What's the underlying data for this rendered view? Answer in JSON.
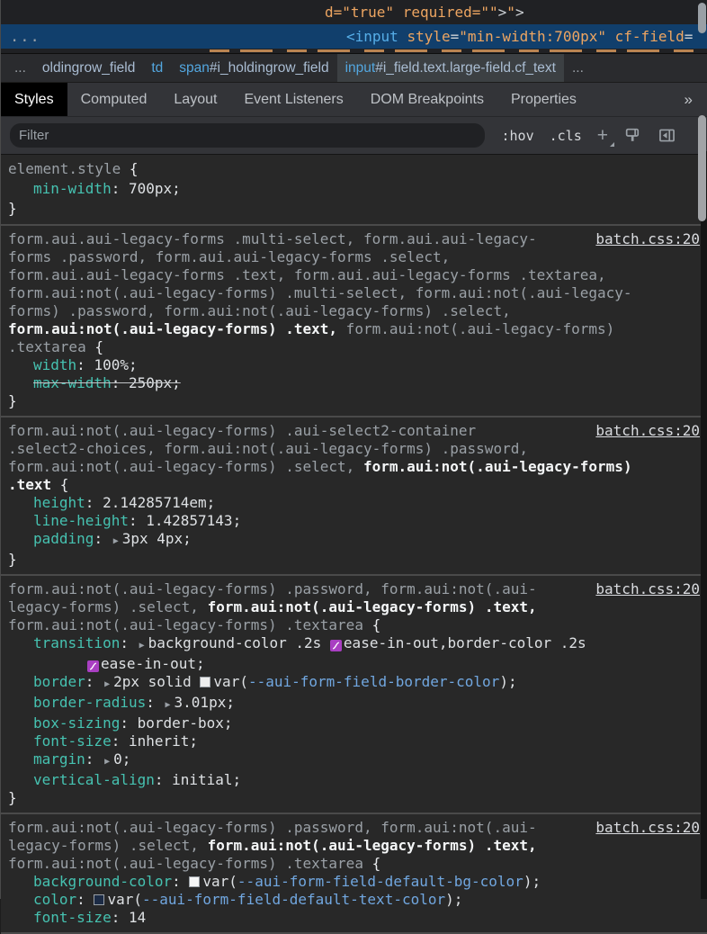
{
  "colors": {
    "selection_blue": "#113f6c",
    "property_teal": "#46c2b1",
    "var_link_blue": "#71a7e0",
    "bezier_purple": "#a93fc2",
    "attr_orange": "#eda561",
    "tag_blue": "#56aee8",
    "dim_gray": "#9aa0a6",
    "swatch_border_color": "#ededed",
    "swatch_bg_color": "#f5f5f5",
    "swatch_text_color": "#1c2b45"
  },
  "elements_panel": {
    "rows": [
      {
        "name": "code-row-attrs",
        "selected": false,
        "tokens": [
          {
            "t": "d=\"true\" required=\"\"",
            "c": "attr"
          },
          {
            "t": ">",
            "c": "punct"
          },
          {
            "t": "\"",
            "c": "attr"
          },
          {
            "t": ">",
            "c": "punct"
          }
        ]
      },
      {
        "name": "code-row-selected-input",
        "selected": true,
        "more": "...",
        "tokens": [
          {
            "t": "<input",
            "c": "tag"
          },
          {
            "t": " ",
            "c": "punct"
          },
          {
            "t": "style",
            "c": "attr"
          },
          {
            "t": "=",
            "c": "punct"
          },
          {
            "t": "\"min-width:700px\"",
            "c": "attr"
          },
          {
            "t": " ",
            "c": "punct"
          },
          {
            "t": "cf-field",
            "c": "attr"
          },
          {
            "t": "=",
            "c": "punct"
          }
        ]
      }
    ]
  },
  "breadcrumb": {
    "items": [
      {
        "parts": [
          {
            "t": "...",
            "c": "dim"
          }
        ]
      },
      {
        "parts": [
          {
            "t": "oldingrow_field",
            "c": "node"
          }
        ]
      },
      {
        "parts": [
          {
            "t": "td",
            "c": "tag"
          }
        ]
      },
      {
        "parts": [
          {
            "t": "span",
            "c": "tag"
          },
          {
            "t": "#i_holdingrow_field",
            "c": "node"
          }
        ]
      },
      {
        "selected": true,
        "parts": [
          {
            "t": "input",
            "c": "tag"
          },
          {
            "t": "#i_field.text.large-field.cf_text",
            "c": "node"
          }
        ]
      },
      {
        "parts": [
          {
            "t": "...",
            "c": "dim"
          }
        ]
      }
    ]
  },
  "tabs": {
    "items": [
      "Styles",
      "Computed",
      "Layout",
      "Event Listeners",
      "DOM Breakpoints",
      "Properties"
    ],
    "active": "Styles",
    "overflow": "»"
  },
  "styles_toolbar": {
    "filter_placeholder": "Filter",
    "pseudo_state_label": ":hov",
    "class_toggle_label": ".cls",
    "new_rule_label": "+"
  },
  "style_sections": [
    {
      "id": "element-style",
      "elem": true,
      "link": null,
      "selector_lines": [
        [
          {
            "t": "element.style",
            "c": "dim"
          },
          {
            "t": " {",
            "c": "brace"
          }
        ]
      ],
      "declarations": [
        {
          "tokens": [
            {
              "k": "prop",
              "v": "min-width"
            },
            {
              "k": "t",
              "v": ": "
            },
            {
              "k": "t",
              "v": "700px;"
            }
          ]
        }
      ],
      "close": "}"
    },
    {
      "id": "rule-1",
      "link": "batch.css:20",
      "selector_lines": [
        [
          {
            "t": "form.aui.aui-legacy-forms .multi-select, form.aui.aui-legacy-",
            "c": "dim"
          }
        ],
        [
          {
            "t": "forms .password, form.aui.aui-legacy-forms .select,",
            "c": "dim"
          }
        ],
        [
          {
            "t": "form.aui.aui-legacy-forms .text, form.aui.aui-legacy-forms .textarea,",
            "c": "dim"
          }
        ],
        [
          {
            "t": "form.aui:not(.aui-legacy-forms) .multi-select, form.aui:not(.aui-legacy-",
            "c": "dim"
          }
        ],
        [
          {
            "t": "forms) .password, form.aui:not(.aui-legacy-forms) .select,",
            "c": "dim"
          }
        ],
        [
          {
            "t": "form.aui:not(.aui-legacy-forms) .text,",
            "c": "bright"
          },
          {
            "t": " form.aui:not(.aui-legacy-forms)",
            "c": "dim"
          }
        ],
        [
          {
            "t": ".textarea",
            "c": "dim"
          },
          {
            "t": " {",
            "c": "brace"
          }
        ]
      ],
      "declarations": [
        {
          "tokens": [
            {
              "k": "prop",
              "v": "width"
            },
            {
              "k": "t",
              "v": ": "
            },
            {
              "k": "t",
              "v": "100%;"
            }
          ]
        },
        {
          "struck": true,
          "tokens": [
            {
              "k": "prop",
              "v": "max-width"
            },
            {
              "k": "t",
              "v": ": "
            },
            {
              "k": "t",
              "v": "250px;"
            }
          ]
        }
      ],
      "close": "}"
    },
    {
      "id": "rule-2",
      "link": "batch.css:20",
      "selector_lines": [
        [
          {
            "t": "form.aui:not(.aui-legacy-forms) .aui-select2-container",
            "c": "dim"
          }
        ],
        [
          {
            "t": ".select2-choices, form.aui:not(.aui-legacy-forms) .password,",
            "c": "dim"
          }
        ],
        [
          {
            "t": "form.aui:not(.aui-legacy-forms) .select, ",
            "c": "dim"
          },
          {
            "t": "form.aui:not(.aui-legacy-forms)",
            "c": "bright"
          }
        ],
        [
          {
            "t": ".text",
            "c": "bright"
          },
          {
            "t": " {",
            "c": "brace"
          }
        ]
      ],
      "declarations": [
        {
          "tokens": [
            {
              "k": "prop",
              "v": "height"
            },
            {
              "k": "t",
              "v": ": "
            },
            {
              "k": "t",
              "v": "2.14285714em;"
            }
          ]
        },
        {
          "tokens": [
            {
              "k": "prop",
              "v": "line-height"
            },
            {
              "k": "t",
              "v": ": "
            },
            {
              "k": "t",
              "v": "1.42857143;"
            }
          ]
        },
        {
          "tokens": [
            {
              "k": "prop",
              "v": "padding"
            },
            {
              "k": "t",
              "v": ": "
            },
            {
              "k": "arrow"
            },
            {
              "k": "t",
              "v": "3px 4px;"
            }
          ]
        }
      ],
      "close": "}"
    },
    {
      "id": "rule-3",
      "link": "batch.css:20",
      "selector_lines": [
        [
          {
            "t": "form.aui:not(.aui-legacy-forms) .password, form.aui:not(.aui-",
            "c": "dim"
          }
        ],
        [
          {
            "t": "legacy-forms) .select, ",
            "c": "dim"
          },
          {
            "t": "form.aui:not(.aui-legacy-forms) .text,",
            "c": "bright"
          }
        ],
        [
          {
            "t": "form.aui:not(.aui-legacy-forms) .textarea",
            "c": "dim"
          },
          {
            "t": " {",
            "c": "brace"
          }
        ]
      ],
      "declarations": [
        {
          "tokens": [
            {
              "k": "prop",
              "v": "transition"
            },
            {
              "k": "t",
              "v": ": "
            },
            {
              "k": "arrow"
            },
            {
              "k": "t",
              "v": "background-color .2s "
            },
            {
              "k": "bezier"
            },
            {
              "k": "t",
              "v": "ease-in-out,border-color .2s"
            }
          ]
        },
        {
          "cont": true,
          "tokens": [
            {
              "k": "bezier"
            },
            {
              "k": "t",
              "v": "ease-in-out;"
            }
          ]
        },
        {
          "tokens": [
            {
              "k": "prop",
              "v": "border"
            },
            {
              "k": "t",
              "v": ": "
            },
            {
              "k": "arrow"
            },
            {
              "k": "t",
              "v": "2px solid "
            },
            {
              "k": "swatch",
              "color": "#ededed"
            },
            {
              "k": "t",
              "v": "var("
            },
            {
              "k": "var",
              "v": "--aui-form-field-border-color"
            },
            {
              "k": "t",
              "v": ");"
            }
          ]
        },
        {
          "tokens": [
            {
              "k": "prop",
              "v": "border-radius"
            },
            {
              "k": "t",
              "v": ": "
            },
            {
              "k": "arrow"
            },
            {
              "k": "t",
              "v": "3.01px;"
            }
          ]
        },
        {
          "tokens": [
            {
              "k": "prop",
              "v": "box-sizing"
            },
            {
              "k": "t",
              "v": ": "
            },
            {
              "k": "t",
              "v": "border-box;"
            }
          ]
        },
        {
          "tokens": [
            {
              "k": "prop",
              "v": "font-size"
            },
            {
              "k": "t",
              "v": ": "
            },
            {
              "k": "t",
              "v": "inherit;"
            }
          ]
        },
        {
          "tokens": [
            {
              "k": "prop",
              "v": "margin"
            },
            {
              "k": "t",
              "v": ": "
            },
            {
              "k": "arrow"
            },
            {
              "k": "t",
              "v": "0;"
            }
          ]
        },
        {
          "tokens": [
            {
              "k": "prop",
              "v": "vertical-align"
            },
            {
              "k": "t",
              "v": ": "
            },
            {
              "k": "t",
              "v": "initial;"
            }
          ]
        }
      ],
      "close": "}"
    },
    {
      "id": "rule-4",
      "link": "batch.css:20",
      "selector_lines": [
        [
          {
            "t": "form.aui:not(.aui-legacy-forms) .password, form.aui:not(.aui-",
            "c": "dim"
          }
        ],
        [
          {
            "t": "legacy-forms) .select, ",
            "c": "dim"
          },
          {
            "t": "form.aui:not(.aui-legacy-forms) .text,",
            "c": "bright"
          }
        ],
        [
          {
            "t": "form.aui:not(.aui-legacy-forms) .textarea",
            "c": "dim"
          },
          {
            "t": " {",
            "c": "brace"
          }
        ]
      ],
      "declarations": [
        {
          "tokens": [
            {
              "k": "prop",
              "v": "background-color"
            },
            {
              "k": "t",
              "v": ": "
            },
            {
              "k": "swatch",
              "color": "#f5f5f5"
            },
            {
              "k": "t",
              "v": "var("
            },
            {
              "k": "var",
              "v": "--aui-form-field-default-bg-color"
            },
            {
              "k": "t",
              "v": ");"
            }
          ]
        },
        {
          "tokens": [
            {
              "k": "prop",
              "v": "color"
            },
            {
              "k": "t",
              "v": ": "
            },
            {
              "k": "swatch",
              "color": "#1c2b45"
            },
            {
              "k": "t",
              "v": "var("
            },
            {
              "k": "var",
              "v": "--aui-form-field-default-text-color"
            },
            {
              "k": "t",
              "v": ");"
            }
          ]
        },
        {
          "tokens": [
            {
              "k": "prop",
              "v": "font-size"
            },
            {
              "k": "t",
              "v": ": "
            },
            {
              "k": "t",
              "v": "14"
            }
          ]
        }
      ],
      "close": null
    }
  ]
}
